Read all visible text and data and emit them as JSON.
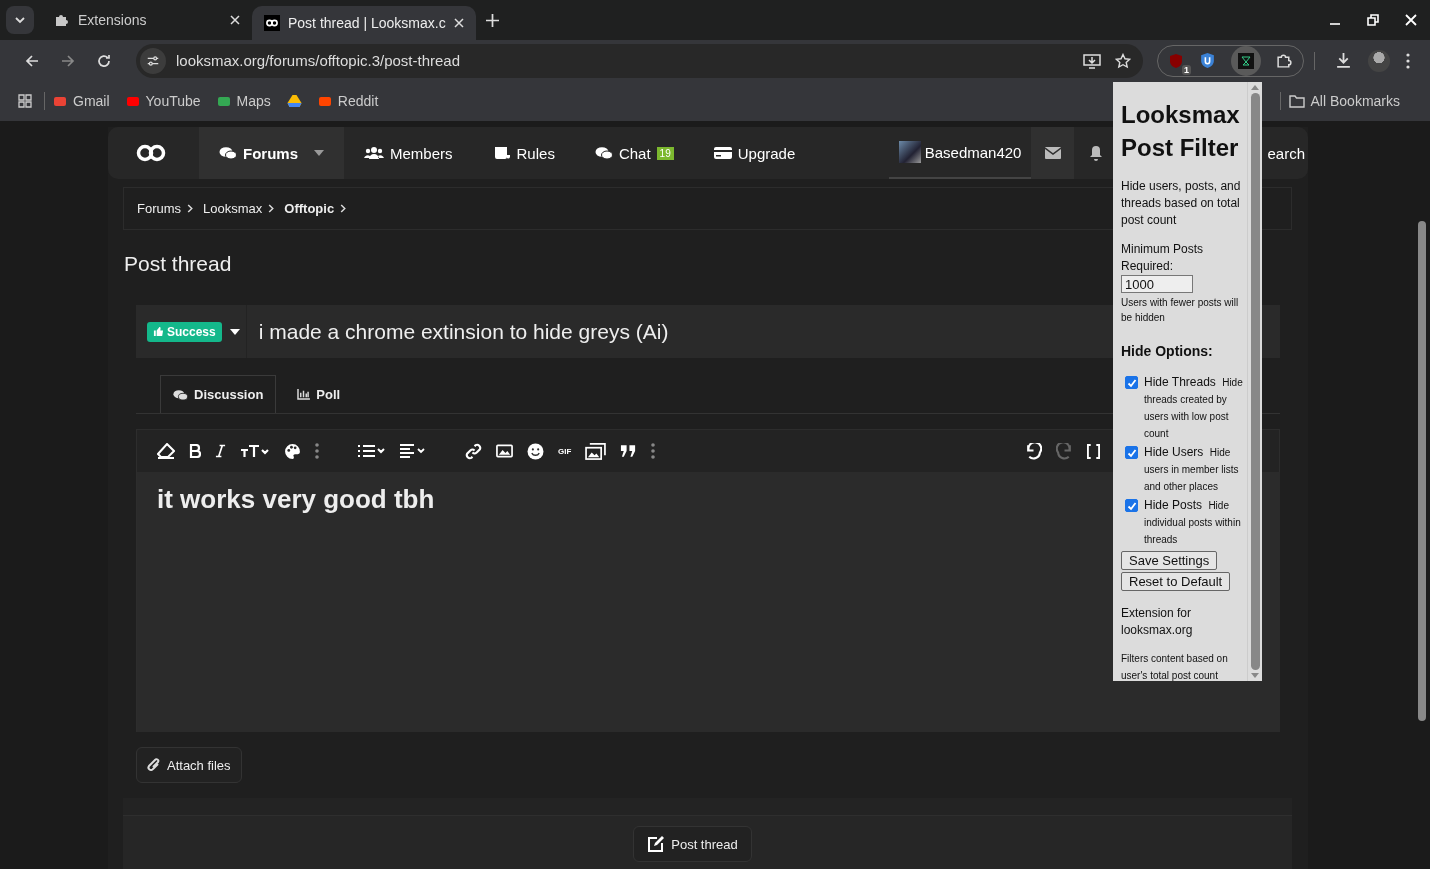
{
  "browser": {
    "tabs": [
      {
        "title": "Extensions",
        "kind": "extensions",
        "selected": false
      },
      {
        "title": "Post thread | Looksmax.c",
        "kind": "site",
        "selected": true
      }
    ],
    "address": "looksmax.org/forums/offtopic.3/post-thread",
    "extension_badge": "1",
    "bookmarks": [
      {
        "label": "Gmail",
        "kind": "gmail"
      },
      {
        "label": "YouTube",
        "kind": "youtube"
      },
      {
        "label": "Maps",
        "kind": "maps"
      },
      {
        "kind": "drive"
      },
      {
        "label": "Reddit",
        "kind": "reddit"
      }
    ],
    "all_bookmarks": "All Bookmarks"
  },
  "nav": {
    "items": [
      {
        "label": "Forums",
        "kind": "forums",
        "selected": true
      },
      {
        "label": "Members",
        "kind": "members",
        "selected": false
      },
      {
        "label": "Rules",
        "kind": "rules",
        "selected": false
      },
      {
        "label": "Chat",
        "kind": "chat",
        "selected": false
      },
      {
        "label": "Upgrade",
        "kind": "upgrade",
        "selected": false
      }
    ],
    "chat_badge": "19",
    "user": "Basedman420",
    "search_fragment": "earch"
  },
  "breadcrumbs": [
    {
      "label": "Forums",
      "current": false
    },
    {
      "label": "Looksmax",
      "current": false
    },
    {
      "label": "Offtopic",
      "current": true
    }
  ],
  "page_title": "Post thread",
  "prefix": "Success",
  "thread_title": "i made a chrome extinsion to hide greys (Ai)",
  "editor_tabs": [
    {
      "label": "Discussion",
      "kind": "discussion",
      "selected": true
    },
    {
      "label": "Poll",
      "kind": "poll",
      "selected": false
    }
  ],
  "gif_label": "GIF",
  "body": "it works very good tbh",
  "attach": "Attach files",
  "submit": "Post thread",
  "popup": {
    "title": "Looksmax Post Filter",
    "description": "Hide users, posts, and threads based on total post count",
    "min_label": "Minimum Posts Required:",
    "min_value": "1000",
    "min_hint": "Users with fewer posts will be hidden",
    "options_heading": "Hide Options:",
    "options": [
      {
        "label": "Hide Threads",
        "hint": "Hide threads created by users with low post count",
        "checked": true
      },
      {
        "label": "Hide Users",
        "hint": "Hide users in member lists and other places",
        "checked": true
      },
      {
        "label": "Hide Posts",
        "hint": "Hide individual posts within threads",
        "checked": true
      }
    ],
    "buttons": [
      "Save Settings",
      "Reset to Default"
    ],
    "footer": "Extension for looksmax.org",
    "footnote": "Filters content based on user's total post count"
  }
}
